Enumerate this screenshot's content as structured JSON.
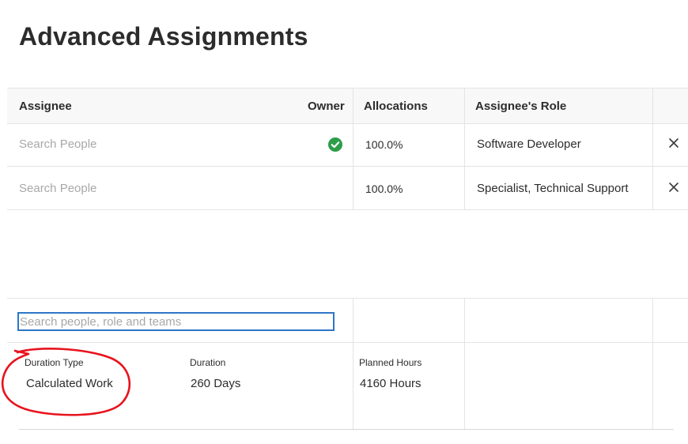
{
  "page": {
    "title": "Advanced Assignments"
  },
  "table": {
    "headers": {
      "assignee": "Assignee",
      "owner": "Owner",
      "allocations": "Allocations",
      "role": "Assignee's Role"
    },
    "rows": [
      {
        "assignee_placeholder": "Search People",
        "owner": true,
        "allocation": "100.0%",
        "role": "Software Developer"
      },
      {
        "assignee_placeholder": "Search People",
        "owner": false,
        "allocation": "100.0%",
        "role": "Specialist, Technical Support"
      }
    ],
    "new_assignee": {
      "placeholder": "Search people, role and teams",
      "value": ""
    }
  },
  "details": {
    "duration_type": {
      "label": "Duration Type",
      "value": "Calculated Work"
    },
    "duration": {
      "label": "Duration",
      "value": "260 Days"
    },
    "planned_hours": {
      "label": "Planned Hours",
      "value": "4160 Hours"
    }
  },
  "icons": {
    "owner_check": "check-circle-icon",
    "remove": "close-icon"
  },
  "colors": {
    "owner_check": "#2d9d4a",
    "input_focus": "#2d76c8",
    "annotation": "#e8131d"
  }
}
